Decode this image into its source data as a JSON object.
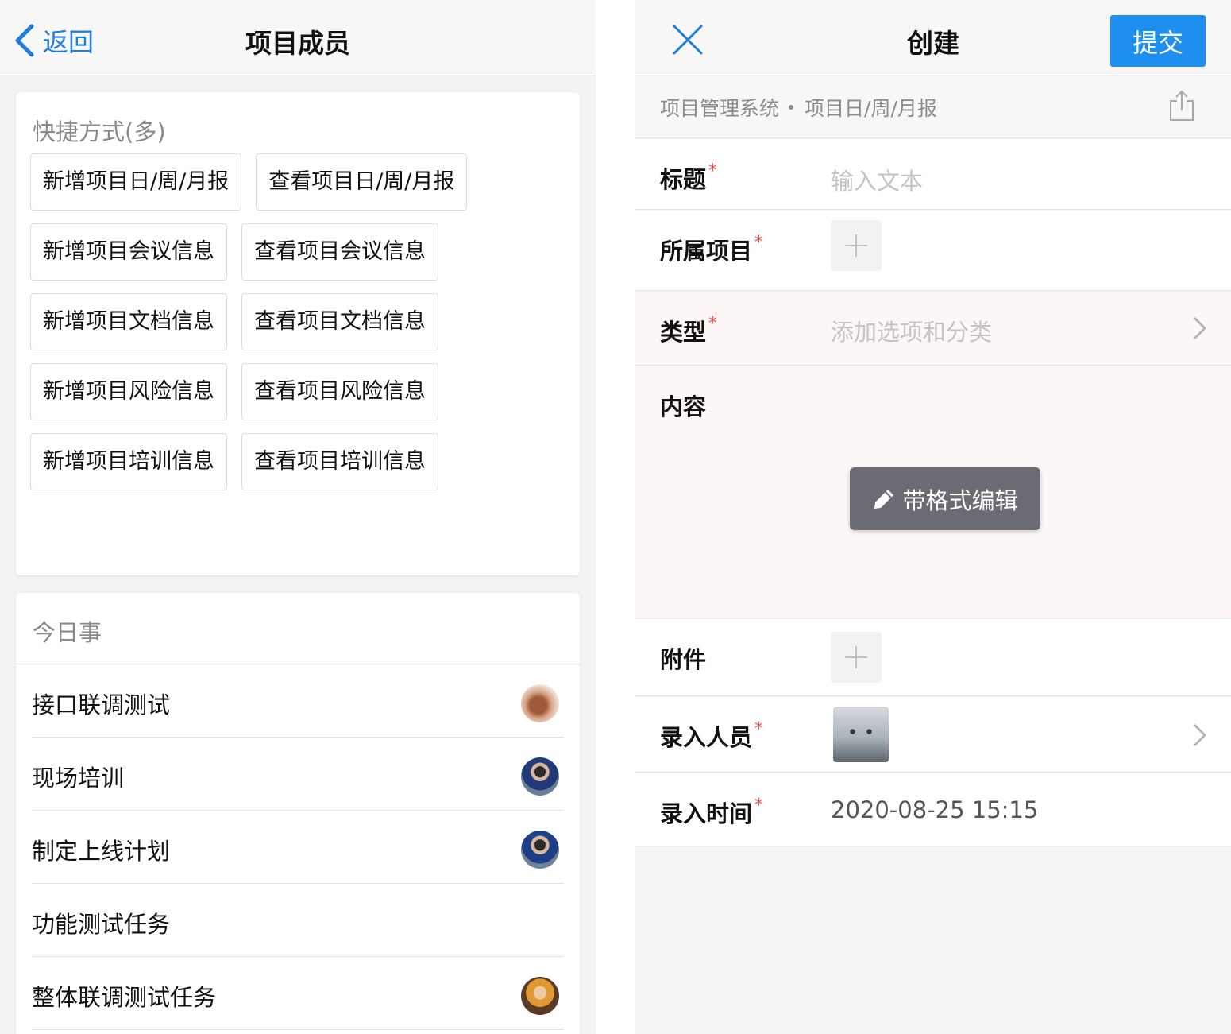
{
  "left": {
    "nav": {
      "back_label": "返回",
      "title": "项目成员"
    },
    "shortcuts": {
      "heading": "快捷方式(多)",
      "rows": [
        [
          "新增项目日/周/月报",
          "查看项目日/周/月报"
        ],
        [
          "新增项目会议信息",
          "查看项目会议信息"
        ],
        [
          "新增项目文档信息",
          "查看项目文档信息"
        ],
        [
          "新增项目风险信息",
          "查看项目风险信息"
        ],
        [
          "新增项目培训信息",
          "查看项目培训信息"
        ]
      ]
    },
    "today": {
      "heading": "今日事",
      "tasks": [
        {
          "label": "接口联调测试",
          "avatar": "avatar-a"
        },
        {
          "label": "现场培训",
          "avatar": "avatar-b"
        },
        {
          "label": "制定上线计划",
          "avatar": "avatar-c"
        },
        {
          "label": "功能测试任务",
          "avatar": ""
        },
        {
          "label": "整体联调测试任务",
          "avatar": "avatar-d"
        }
      ]
    }
  },
  "right": {
    "nav": {
      "title": "创建",
      "submit_label": "提交"
    },
    "breadcrumb": {
      "app": "项目管理系统",
      "page": "项目日/周/月报"
    },
    "form": {
      "title_label": "标题",
      "title_placeholder": "输入文本",
      "project_label": "所属项目",
      "type_label": "类型",
      "type_placeholder": "添加选项和分类",
      "content_label": "内容",
      "rich_edit_label": "带格式编辑",
      "attachment_label": "附件",
      "recorder_label": "录入人员",
      "time_label": "录入时间",
      "time_value": "2020-08-25 15:15",
      "required_mark": "*"
    }
  },
  "colors": {
    "accent": "#1e8fef",
    "link": "#1f7ce0",
    "required": "#f05050",
    "pink_row": "#fdf6f6"
  }
}
